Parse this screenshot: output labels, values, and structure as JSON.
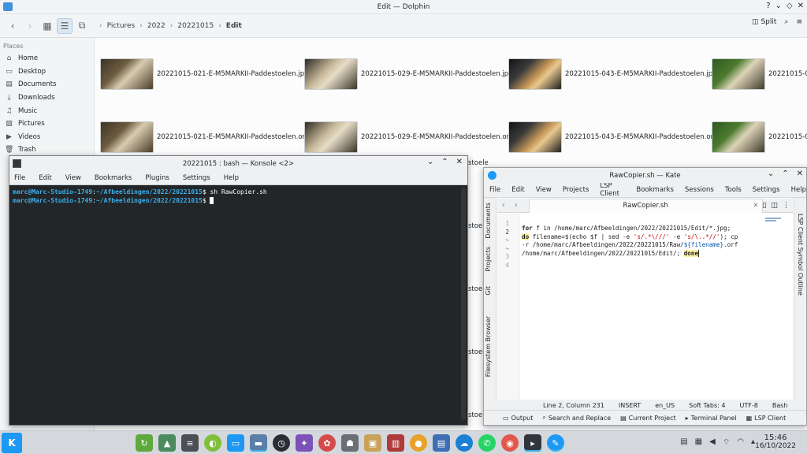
{
  "dolphin": {
    "title": "Edit — Dolphin",
    "breadcrumbs": [
      "Pictures",
      "2022",
      "20221015",
      "Edit"
    ],
    "split_label": "Split",
    "places_header": "Places",
    "places": [
      {
        "label": "Home",
        "icon": "home-icon",
        "glyph": "⌂"
      },
      {
        "label": "Desktop",
        "icon": "desktop-icon",
        "glyph": "▭"
      },
      {
        "label": "Documents",
        "icon": "documents-icon",
        "glyph": "▤"
      },
      {
        "label": "Downloads",
        "icon": "downloads-icon",
        "glyph": "⤓"
      },
      {
        "label": "Music",
        "icon": "music-icon",
        "glyph": "♫"
      },
      {
        "label": "Pictures",
        "icon": "pictures-icon",
        "glyph": "▨"
      },
      {
        "label": "Videos",
        "icon": "videos-icon",
        "glyph": "▶"
      },
      {
        "label": "Trash",
        "icon": "trash-icon",
        "glyph": "🗑"
      }
    ],
    "files": [
      {
        "name": "20221015-021-E-M5MARKII-Paddestoelen.jpg",
        "thumb": "t1"
      },
      {
        "name": "20221015-029-E-M5MARKII-Paddestoelen.jpg",
        "thumb": "t2"
      },
      {
        "name": "20221015-043-E-M5MARKII-Paddestoelen.jpg",
        "thumb": "t3"
      },
      {
        "name": "20221015-0",
        "thumb": "t4"
      },
      {
        "name": "20221015-021-E-M5MARKII-Paddestoelen.orf",
        "thumb": "t1"
      },
      {
        "name": "20221015-029-E-M5MARKII-Paddestoelen.orf",
        "thumb": "t2"
      },
      {
        "name": "20221015-043-E-M5MARKII-Paddestoelen.orf",
        "thumb": "t3"
      },
      {
        "name": "20221015-0",
        "thumb": "t4"
      }
    ],
    "partial_file_text": [
      "stoele",
      "stoele",
      "stoele",
      "stoele",
      "stoele"
    ]
  },
  "konsole": {
    "title": "20221015 : bash — Konsole <2>",
    "menu": [
      "File",
      "Edit",
      "View",
      "Bookmarks",
      "Plugins",
      "Settings",
      "Help"
    ],
    "lines": [
      {
        "user": "marc@Marc-Studio-1749",
        "path": "~/Afbeeldingen/2022/20221015",
        "cmd": "sh RawCopier.sh"
      },
      {
        "user": "marc@Marc-Studio-1749",
        "path": "~/Afbeeldingen/2022/20221015",
        "cmd": ""
      }
    ]
  },
  "kate": {
    "title": "RawCopier.sh — Kate",
    "menu": [
      "File",
      "Edit",
      "View",
      "Projects",
      "LSP Client",
      "Bookmarks",
      "Sessions",
      "Tools",
      "Settings",
      "Help"
    ],
    "tab": "RawCopier.sh",
    "left_tabs": [
      "Documents",
      "Projects",
      "Git",
      "Filesystem Browser"
    ],
    "right_tab": "LSP Client Symbol Outline",
    "line_numbers": [
      "1",
      "2",
      "↪",
      "↪",
      "3",
      "4"
    ],
    "code": {
      "l1_kw": "for",
      "l1_rest": " f in /home/marc/Afbeeldingen/2022/20221015/Edit/*.jpg;",
      "l2_kw": "do",
      "l2_a": " filename=$(echo $f | sed -e ",
      "l2_s1": "'s/.*\\///'",
      "l2_b": " -e ",
      "l2_s2": "'s/\\..*//'",
      "l2_c": "); cp",
      "l3_a": "-r /home/marc/Afbeeldingen/2022/20221015/Raw/",
      "l3_var": "${filename}",
      "l3_b": ".orf",
      "l4_a": "/home/marc/Afbeeldingen/2022/20221015/Edit/; ",
      "l4_kw": "done"
    },
    "status": [
      "Line 2, Column 231",
      "INSERT",
      "en_US",
      "Soft Tabs: 4",
      "UTF-8",
      "Bash"
    ],
    "bottom": [
      {
        "label": "Output",
        "icon": "output-icon"
      },
      {
        "label": "Search and Replace",
        "icon": "search-icon"
      },
      {
        "label": "Current Project",
        "icon": "project-icon"
      },
      {
        "label": "Terminal Panel",
        "icon": "terminal-icon"
      },
      {
        "label": "LSP Client",
        "icon": "lsp-icon"
      }
    ]
  },
  "taskbar": {
    "time": "15:46",
    "date": "16/10/2022"
  }
}
